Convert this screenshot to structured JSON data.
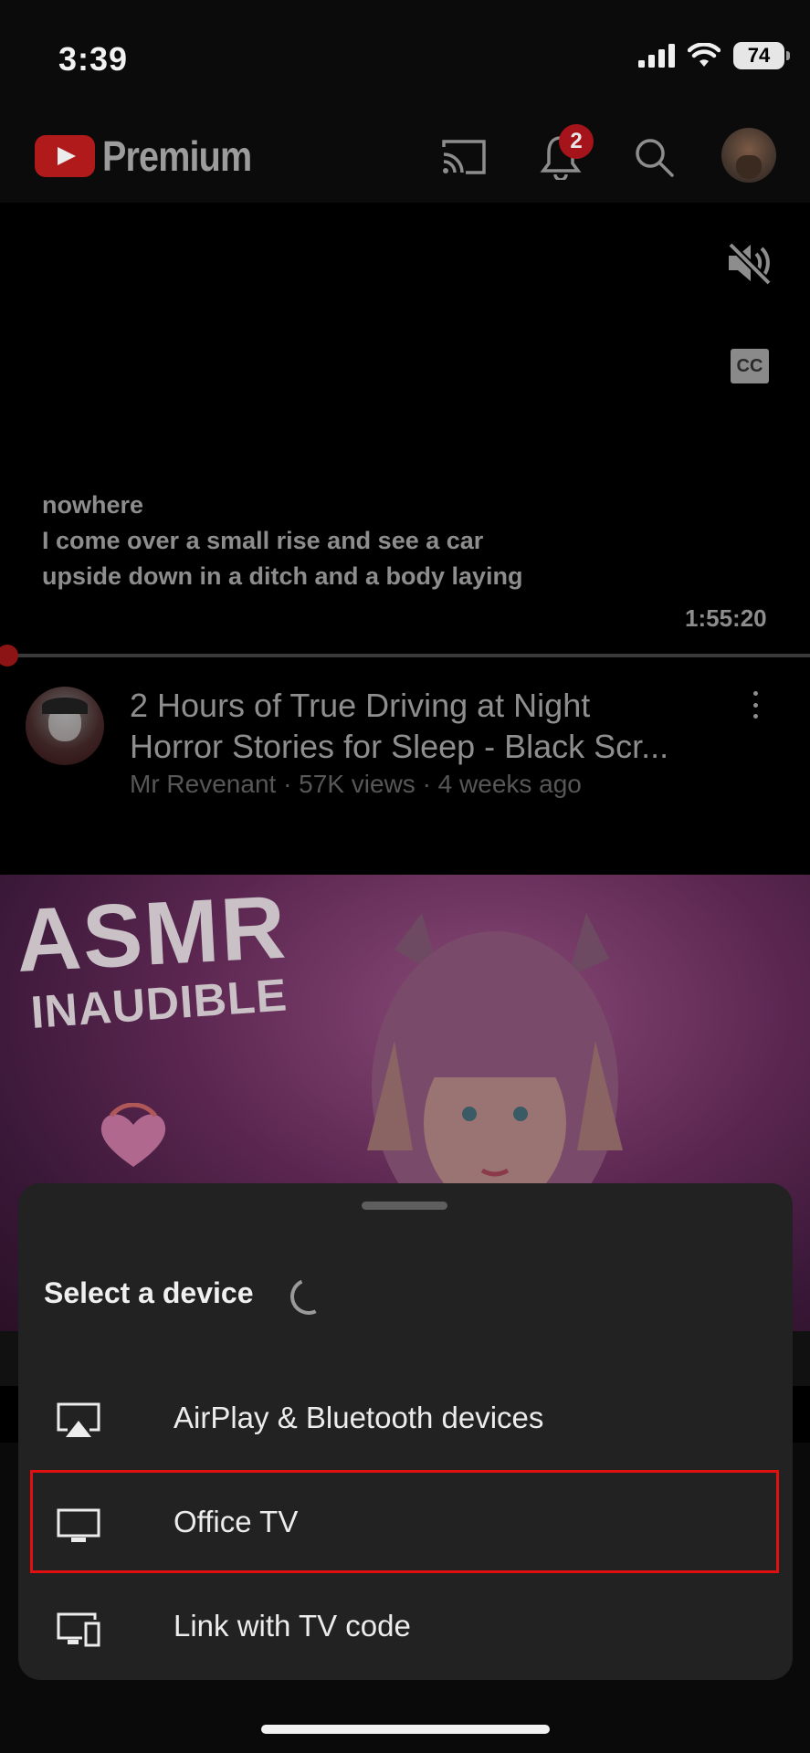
{
  "status_bar": {
    "time": "3:39",
    "battery": "74"
  },
  "header": {
    "brand": "Premium",
    "notification_count": "2"
  },
  "player": {
    "captions": [
      "nowhere",
      "I come over a small rise and see a car",
      "upside down in a ditch and a body laying"
    ],
    "cc_label": "CC",
    "duration": "1:55:20",
    "progress": 0
  },
  "video": {
    "title_line1": "2 Hours of True Driving at Night",
    "title_line2": "Horror Stories for Sleep - Black Scr...",
    "meta": "Mr Revenant · 57K views · 4 weeks ago"
  },
  "thumbnail": {
    "line1": "ASMR",
    "line2": "INAUDIBLE"
  },
  "sheet": {
    "title": "Select a device",
    "devices": [
      {
        "label": "AirPlay & Bluetooth devices",
        "icon": "airplay-icon"
      },
      {
        "label": "Office TV",
        "icon": "tv-icon"
      },
      {
        "label": "Link with TV code",
        "icon": "link-tv-icon"
      }
    ]
  },
  "colors": {
    "highlight": "#e01010",
    "brand_red": "#b01a1a",
    "sheet_bg": "#222222"
  }
}
